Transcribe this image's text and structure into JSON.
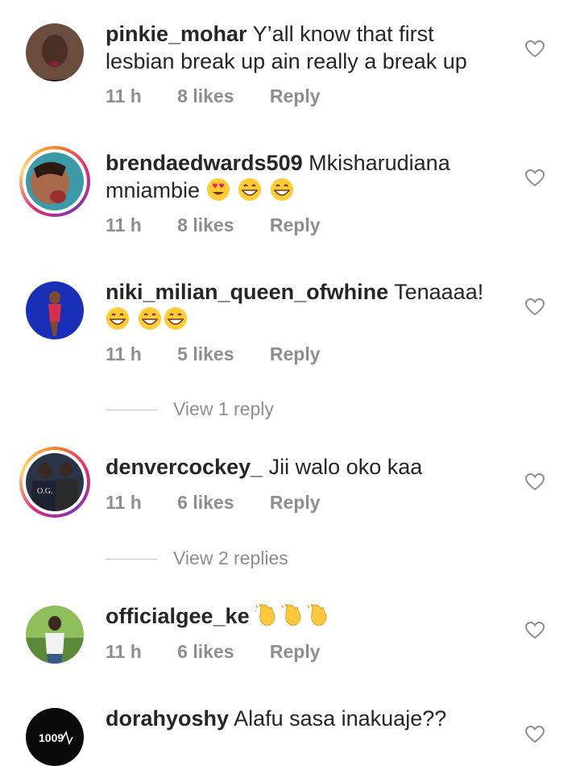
{
  "comments": [
    {
      "username": "pinkie_mohar",
      "text": "Y’all know that first lesbian break up ain really a break up",
      "emojis": [],
      "time": "11 h",
      "likes": "8 likes",
      "reply": "Reply"
    },
    {
      "username": "brendaedwards509",
      "text": "Mkisharudiana mniambie",
      "emojis": [
        "heart-eyes",
        "grin",
        "grin"
      ],
      "time": "11 h",
      "likes": "8 likes",
      "reply": "Reply"
    },
    {
      "username": "niki_milian_queen_ofwhine",
      "text": "Tenaaaa!",
      "emojis": [
        "grin",
        "grin",
        "grin"
      ],
      "time": "11 h",
      "likes": "5 likes",
      "reply": "Reply",
      "view_replies": "View 1 reply"
    },
    {
      "username": "denvercockey_",
      "text": "Jii walo oko kaa",
      "emojis": [],
      "time": "11 h",
      "likes": "6 likes",
      "reply": "Reply",
      "view_replies": "View 2 replies"
    },
    {
      "username": "officialgee_ke",
      "text": "",
      "emojis": [
        "clap",
        "clap",
        "clap"
      ],
      "time": "11 h",
      "likes": "6 likes",
      "reply": "Reply"
    },
    {
      "username": "dorahyoshy",
      "text": "Alafu sasa inakuaje??",
      "emojis": [],
      "time": "",
      "likes": "",
      "reply": ""
    }
  ],
  "avatar_texts": {
    "denvercockey_": "O.G.",
    "dorahyoshy": "1009"
  },
  "colors": {
    "text": "#262626",
    "meta": "#8e8e8e",
    "story_ring": "#dd2a7b"
  }
}
